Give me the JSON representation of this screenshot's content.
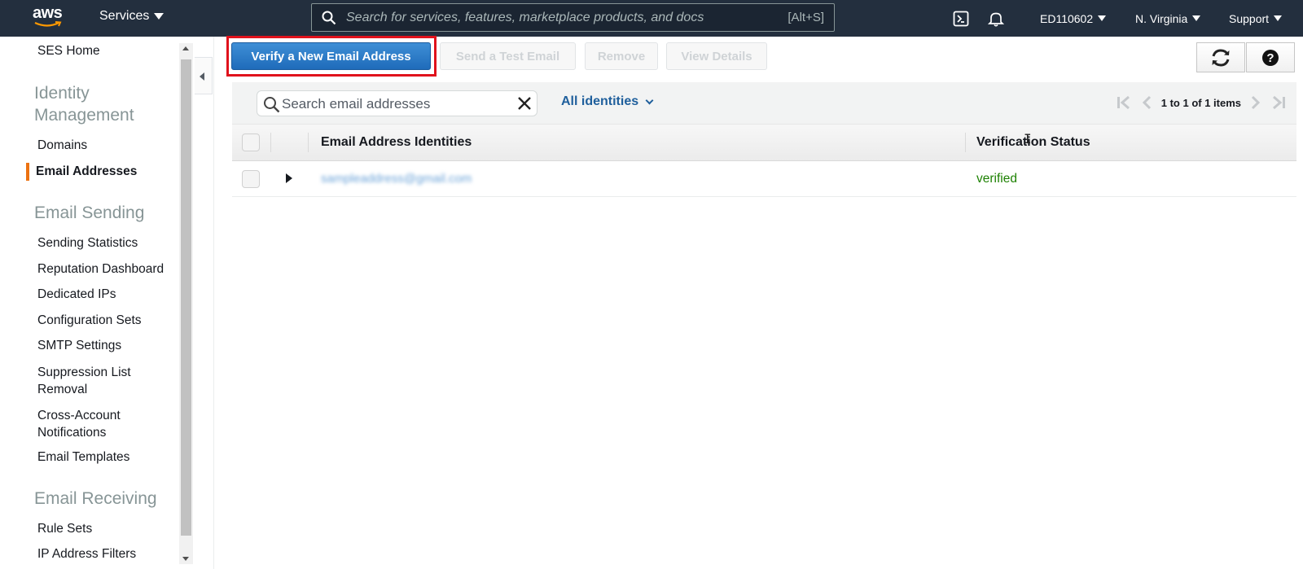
{
  "topnav": {
    "logo_text": "aws",
    "services_label": "Services",
    "search_placeholder": "Search for services, features, marketplace products, and docs",
    "search_shortcut": "[Alt+S]",
    "account": "ED110602",
    "region": "N. Virginia",
    "support": "Support",
    "icons": [
      "search-icon",
      "cloudshell-icon",
      "bell-icon"
    ]
  },
  "sidebar": {
    "home": "SES Home",
    "sections": [
      {
        "title": "Identity Management",
        "items": [
          "Domains",
          "Email Addresses"
        ]
      },
      {
        "title": "Email Sending",
        "items": [
          "Sending Statistics",
          "Reputation Dashboard",
          "Dedicated IPs",
          "Configuration Sets",
          "SMTP Settings",
          "Suppression List Removal",
          "Cross-Account Notifications",
          "Email Templates"
        ]
      },
      {
        "title": "Email Receiving",
        "items": [
          "Rule Sets",
          "IP Address Filters"
        ]
      }
    ],
    "active_item": "Email Addresses",
    "accent_color": "#ec7211"
  },
  "toolbar": {
    "verify_label": "Verify a New Email Address",
    "test_label": "Send a Test Email",
    "remove_label": "Remove",
    "details_label": "View Details",
    "icons": [
      "refresh-icon",
      "help-icon"
    ]
  },
  "table": {
    "search_placeholder": "Search email addresses",
    "filter_label": "All identities",
    "pagination": "1 to 1 of 1 items",
    "columns": [
      "Email Address Identities",
      "Verification Status"
    ],
    "rows": [
      {
        "email": "sampleaddress@gmail.com",
        "status": "verified"
      }
    ],
    "status_color": "#1d8102",
    "primary_color": "#1f6bba"
  }
}
